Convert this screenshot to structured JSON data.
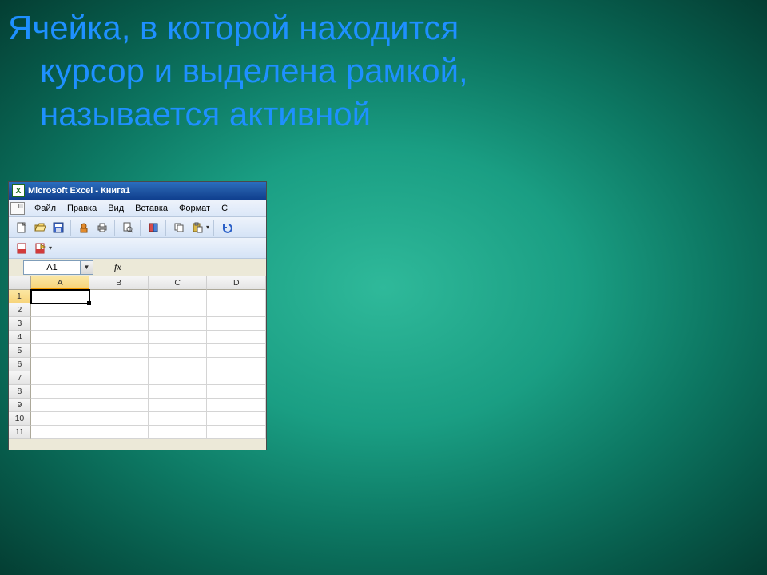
{
  "heading": {
    "line1": "Ячейка, в которой находится",
    "line2": "курсор и выделена рамкой,",
    "line3": "называется активной"
  },
  "excel": {
    "title": "Microsoft Excel - Книга1",
    "appicon_glyph": "X",
    "menu": {
      "file": "Файл",
      "edit": "Правка",
      "view": "Вид",
      "insert": "Вставка",
      "format": "Формат",
      "trailing": "С"
    },
    "namebox": "A1",
    "fx_label": "fx",
    "columns": [
      "A",
      "B",
      "C",
      "D"
    ],
    "rows": [
      "1",
      "2",
      "3",
      "4",
      "5",
      "6",
      "7",
      "8",
      "9",
      "10",
      "11"
    ],
    "active_cell": "A1"
  }
}
